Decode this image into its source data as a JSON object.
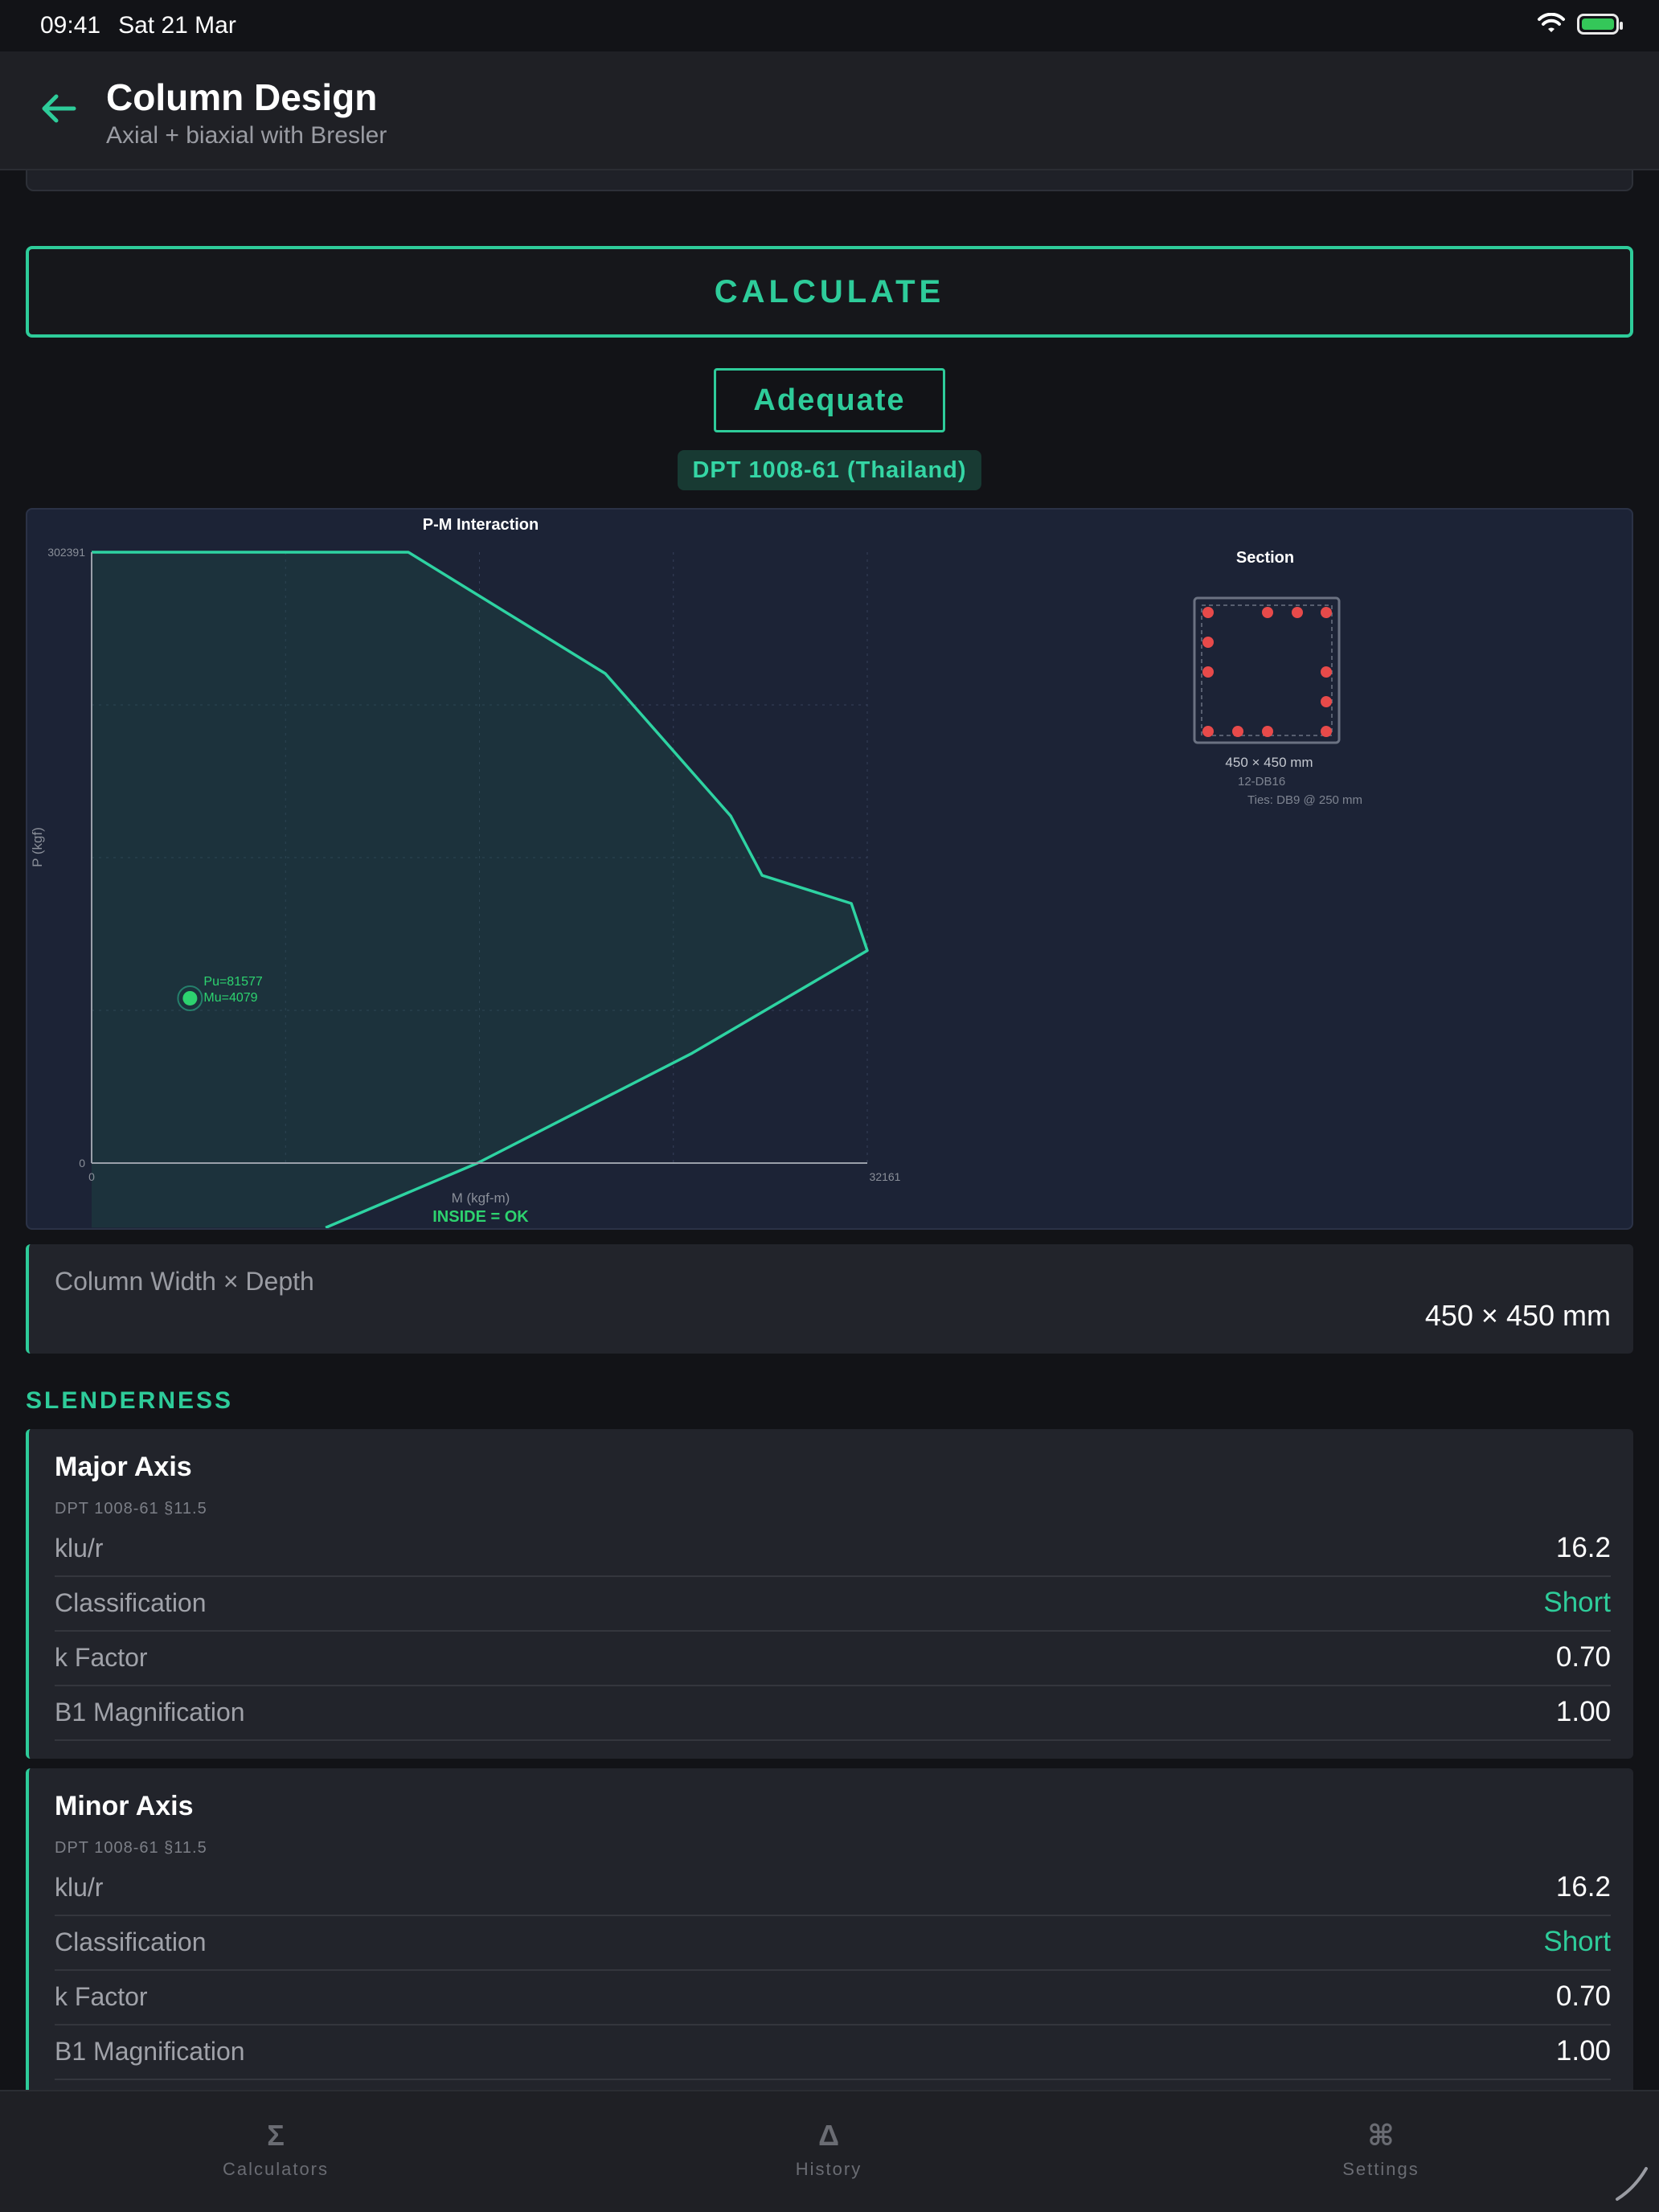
{
  "status": {
    "time": "09:41",
    "date": "Sat 21 Mar"
  },
  "header": {
    "title": "Column Design",
    "subtitle": "Axial + biaxial with Bresler"
  },
  "actions": {
    "calculate_label": "CALCULATE"
  },
  "result": {
    "verdict": "Adequate",
    "code": "DPT 1008-61 (Thailand)"
  },
  "chart_data": {
    "type": "line",
    "title": "P-M Interaction",
    "xlabel": "M (kgf-m)",
    "ylabel": "P (kgf)",
    "xlim": [
      0,
      32161
    ],
    "ylim": [
      0,
      302391
    ],
    "x_tick_labels": [
      "0",
      "32161"
    ],
    "y_tick_labels": [
      "0",
      "302391"
    ],
    "series": [
      {
        "points": [
          [
            0,
            302391
          ],
          [
            13130,
            302391
          ],
          [
            21300,
            242300
          ],
          [
            26500,
            171800
          ],
          [
            27800,
            142400
          ],
          [
            31500,
            128500
          ],
          [
            32161,
            105200
          ],
          [
            24900,
            54400
          ],
          [
            16000,
            0
          ],
          [
            9700,
            -32000
          ]
        ]
      }
    ],
    "demand_point": {
      "M": 4079,
      "P": 81577,
      "label_p": "Pu=81577",
      "label_m": "Mu=4079"
    },
    "status_text": "INSIDE = OK",
    "grid": true
  },
  "section": {
    "title": "Section",
    "dims": "450 × 450 mm",
    "bars": "12-DB16",
    "ties": "Ties: DB9 @ 250 mm",
    "bar_color": "#e74a4a"
  },
  "dimension_card": {
    "label": "Column Width × Depth",
    "value": "450 × 450 mm"
  },
  "slenderness": {
    "title": "SLENDERNESS",
    "major": {
      "name": "Major Axis",
      "ref": "DPT 1008-61 §11.5",
      "rows": [
        {
          "k": "klu/r",
          "v": "16.2"
        },
        {
          "k": "Classification",
          "v": "Short"
        },
        {
          "k": "k Factor",
          "v": "0.70"
        },
        {
          "k": "B1 Magnification",
          "v": "1.00"
        }
      ]
    },
    "minor": {
      "name": "Minor Axis",
      "ref": "DPT 1008-61 §11.5",
      "rows": [
        {
          "k": "klu/r",
          "v": "16.2"
        },
        {
          "k": "Classification",
          "v": "Short"
        },
        {
          "k": "k Factor",
          "v": "0.70"
        },
        {
          "k": "B1 Magnification",
          "v": "1.00"
        }
      ]
    }
  },
  "tabs": [
    {
      "glyph": "Σ",
      "label": "Calculators",
      "icon": "sigma-icon"
    },
    {
      "glyph": "Δ",
      "label": "History",
      "icon": "delta-icon"
    },
    {
      "glyph": "⌘",
      "label": "Settings",
      "icon": "command-icon"
    }
  ],
  "colors": {
    "accent": "#2ecc9a",
    "background": "#121317",
    "card": "#22242b",
    "chart_bg": "#1c2336"
  }
}
